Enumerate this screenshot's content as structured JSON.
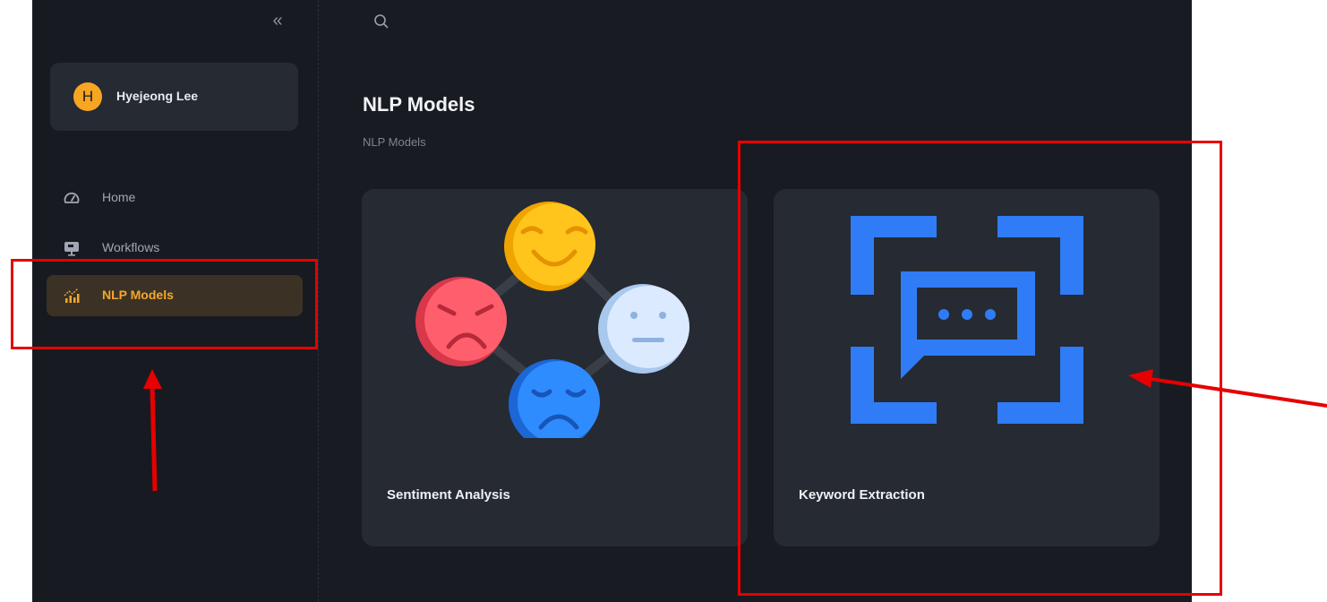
{
  "sidebar": {
    "collapse_icon": "double-chevron-left-icon",
    "user": {
      "initial": "H",
      "name": "Hyejeong Lee"
    },
    "nav": [
      {
        "label": "Home",
        "icon": "speedometer-icon",
        "active": false
      },
      {
        "label": "Workflows",
        "icon": "monitor-icon",
        "active": false
      },
      {
        "label": "NLP Models",
        "icon": "bar-chart-icon",
        "active": true
      }
    ]
  },
  "header": {
    "search_icon": "search-icon"
  },
  "main": {
    "title": "NLP Models",
    "breadcrumb": "NLP Models",
    "cards": [
      {
        "label": "Sentiment Analysis",
        "icon": "emotion-faces-icon"
      },
      {
        "label": "Keyword Extraction",
        "icon": "chat-scan-icon"
      }
    ]
  },
  "colors": {
    "background": "#181c22",
    "sidebar": "#171b21",
    "card": "#252a33",
    "accent": "#f4a82a",
    "active_nav_bg": "#3b3225",
    "keyword_icon": "#2f7cf6",
    "annotation": "#e60000"
  }
}
